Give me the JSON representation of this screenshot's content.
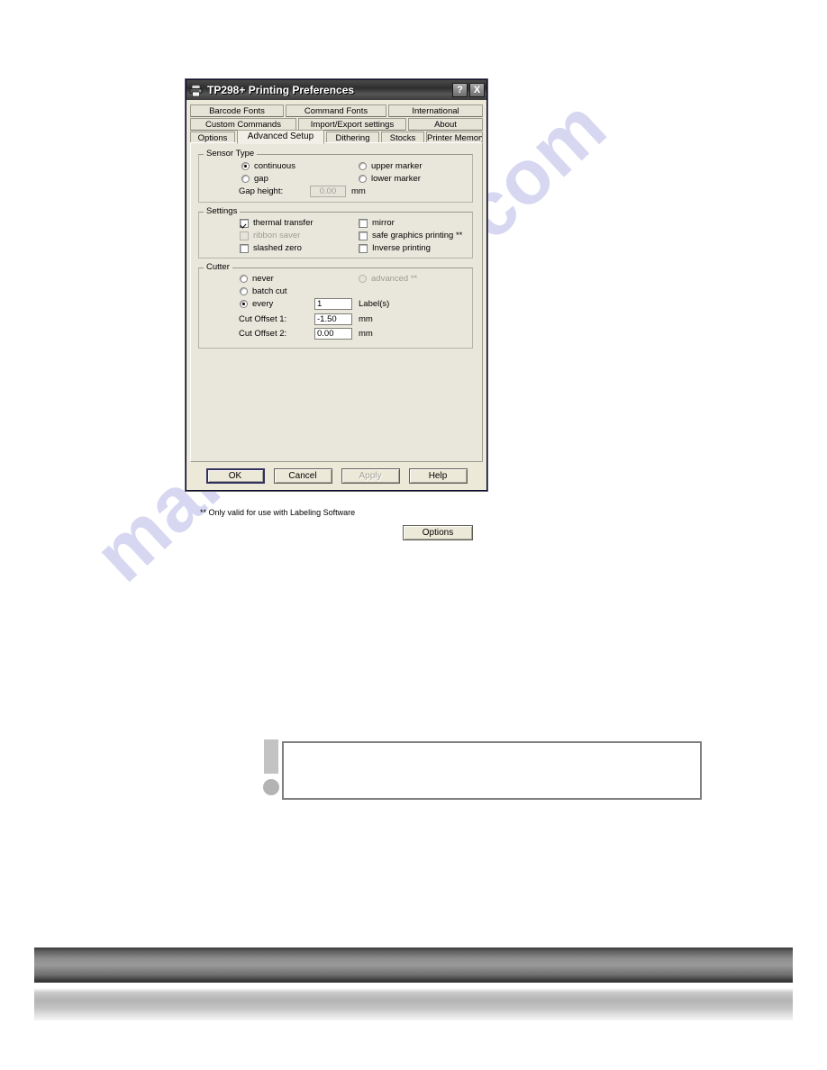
{
  "watermark": {
    "text": "manualshive.com"
  },
  "dialog": {
    "title": "TP298+ Printing Preferences",
    "title_icon": "printer-icon",
    "help_button": "?",
    "close_button": "X",
    "tab_rows": [
      [
        {
          "label": "Barcode Fonts",
          "active": false
        },
        {
          "label": "Command Fonts",
          "active": false
        },
        {
          "label": "International",
          "active": false
        }
      ],
      [
        {
          "label": "Custom Commands",
          "active": false
        },
        {
          "label": "Import/Export settings",
          "active": false
        },
        {
          "label": "About",
          "active": false
        }
      ],
      [
        {
          "label": "Options",
          "active": false
        },
        {
          "label": "Advanced Setup",
          "active": true
        },
        {
          "label": "Dithering",
          "active": false
        },
        {
          "label": "Stocks",
          "active": false
        },
        {
          "label": "Printer Memory",
          "active": false
        }
      ]
    ],
    "sensor_type": {
      "group_label": "Sensor Type",
      "continuous": "continuous",
      "gap": "gap",
      "upper_marker": "upper marker",
      "lower_marker": "lower marker",
      "gap_height_label": "Gap height:",
      "gap_height_value": "0.00",
      "gap_height_unit": "mm"
    },
    "settings": {
      "group_label": "Settings",
      "thermal_transfer": "thermal transfer",
      "ribbon_saver": "ribbon saver",
      "slashed_zero": "slashed zero",
      "mirror": "mirror",
      "safe_graphics_printing": "safe graphics printing **",
      "inverse_printing": "Inverse printing"
    },
    "cutter": {
      "group_label": "Cutter",
      "never": "never",
      "batch_cut": "batch cut",
      "every": "every",
      "every_value": "1",
      "every_unit": "Label(s)",
      "advanced": "advanced **",
      "cut_offset_1_label": "Cut Offset 1:",
      "cut_offset_1_value": "-1.50",
      "cut_offset_1_unit": "mm",
      "cut_offset_2_label": "Cut Offset 2:",
      "cut_offset_2_value": "0.00",
      "cut_offset_2_unit": "mm"
    },
    "footnote": "** Only valid for use with Labeling Software",
    "options_button": "Options",
    "footer": {
      "ok": "OK",
      "cancel": "Cancel",
      "apply": "Apply",
      "help": "Help"
    }
  },
  "note": {
    "icon": "exclamation-icon",
    "text": ""
  }
}
